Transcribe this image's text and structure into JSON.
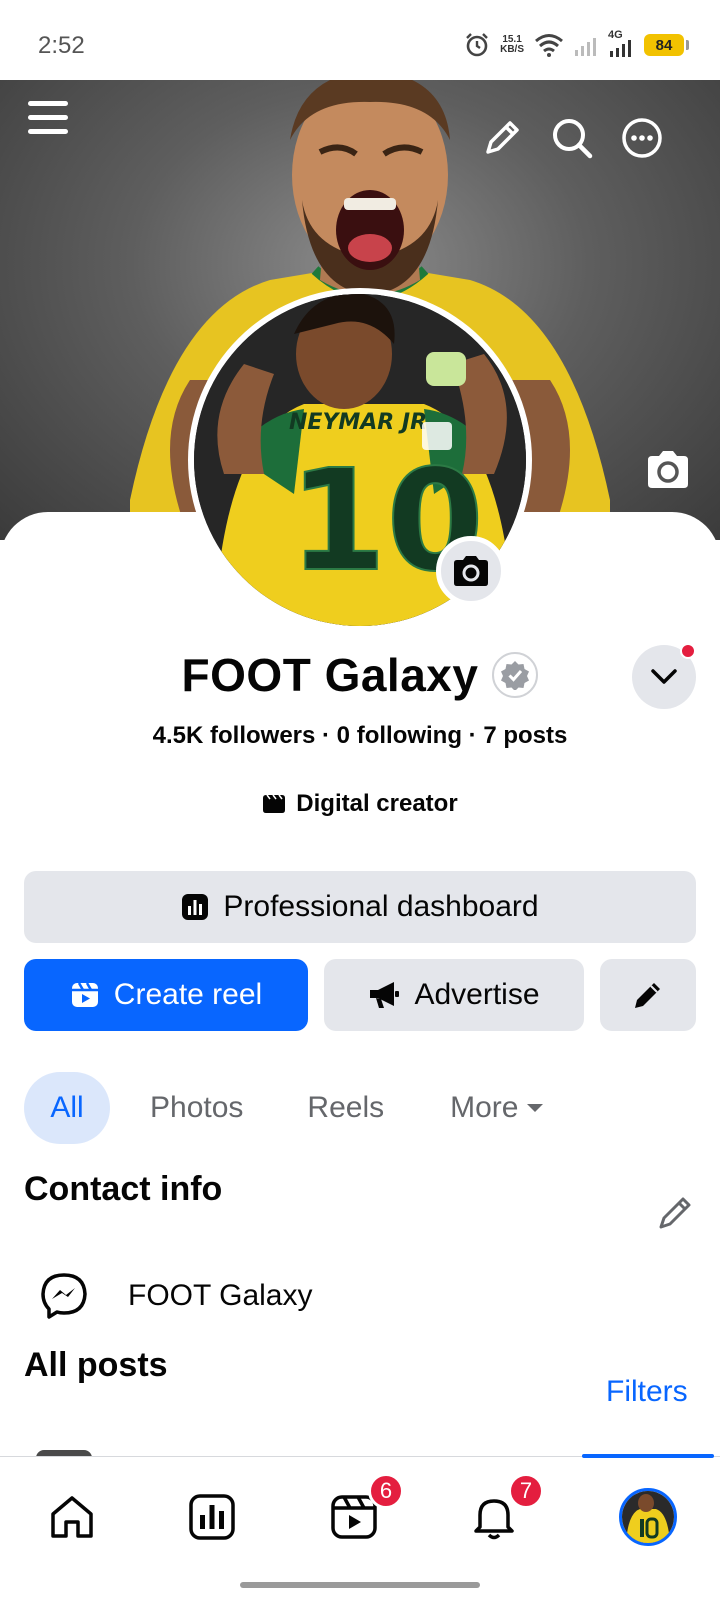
{
  "status_bar": {
    "time": "2:52",
    "net_speed_value": "15.1",
    "net_speed_unit": "KB/S",
    "network_type": "4G",
    "battery": "84"
  },
  "profile": {
    "name": "FOOT Galaxy",
    "stats": "4.5K followers · 0 following · 7 posts",
    "category": "Digital creator",
    "jersey_text": "NEYMAR JR",
    "jersey_number": "10"
  },
  "actions": {
    "dashboard_label": "Professional dashboard",
    "create_reel_label": "Create reel",
    "advertise_label": "Advertise"
  },
  "tabs": [
    {
      "label": "All"
    },
    {
      "label": "Photos"
    },
    {
      "label": "Reels"
    },
    {
      "label": "More"
    }
  ],
  "contact": {
    "title": "Contact info",
    "messenger_name": "FOOT Galaxy"
  },
  "posts": {
    "title": "All posts",
    "filters_label": "Filters"
  },
  "bottom_nav": {
    "reels_badge": "6",
    "notifications_badge": "7"
  },
  "colors": {
    "accent": "#0866ff",
    "badge": "#e41e3f",
    "secondary_button": "#e4e6eb"
  }
}
